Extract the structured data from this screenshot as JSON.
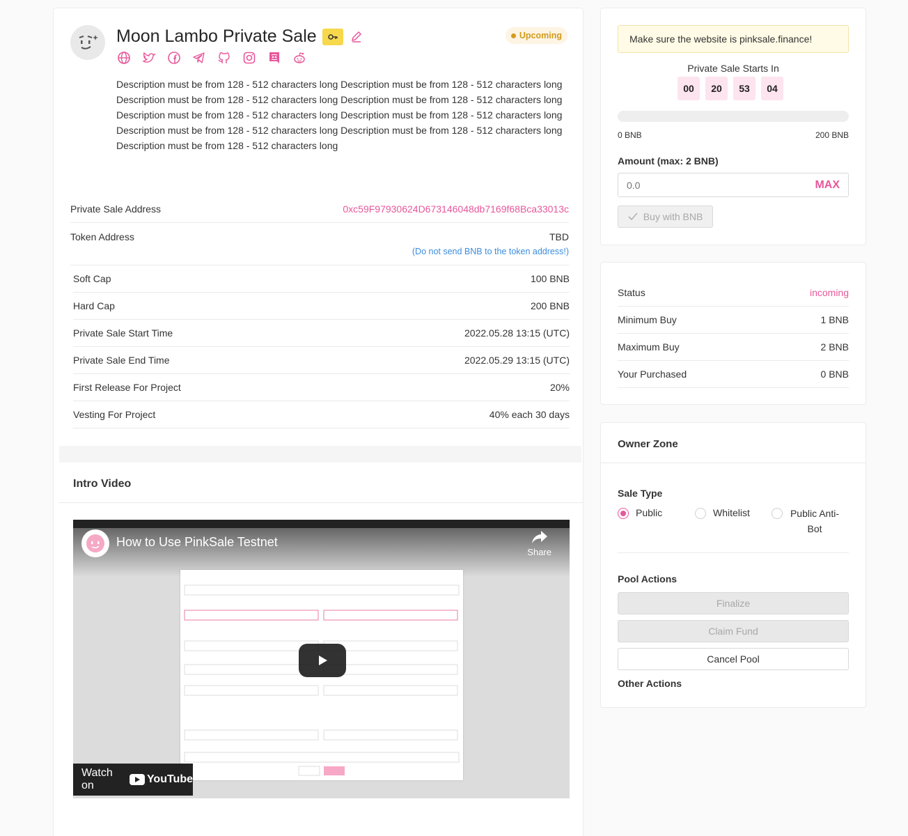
{
  "project": {
    "title": "Moon Lambo Private Sale",
    "status": "Upcoming",
    "description": "Description must be from 128 - 512 characters long Description must be from 128 - 512 characters long Description must be from 128 - 512 characters long Description must be from 128 - 512 characters long Description must be from 128 - 512 characters long Description must be from 128 - 512 characters long Description must be from 128 - 512 characters long Description must be from 128 - 512 characters long Description must be from 128 - 512 characters long",
    "socials": [
      "globe-icon",
      "twitter-icon",
      "facebook-icon",
      "telegram-icon",
      "github-icon",
      "instagram-icon",
      "discord-icon",
      "reddit-icon"
    ]
  },
  "info": {
    "private_sale_address_label": "Private Sale Address",
    "private_sale_address": "0xc59F97930624D673146048db7169f68Bca33013c",
    "token_address_label": "Token Address",
    "token_address": "TBD",
    "token_hint": "(Do not send BNB to the token address!)",
    "rows": [
      {
        "label": "Soft Cap",
        "value": "100 BNB"
      },
      {
        "label": "Hard Cap",
        "value": "200 BNB"
      },
      {
        "label": "Private Sale Start Time",
        "value": "2022.05.28 13:15 (UTC)"
      },
      {
        "label": "Private Sale End Time",
        "value": "2022.05.29 13:15 (UTC)"
      },
      {
        "label": "First Release For Project",
        "value": "20%"
      },
      {
        "label": "Vesting For Project",
        "value": "40% each 30 days"
      }
    ]
  },
  "video": {
    "section_title": "Intro Video",
    "yt_title": "How to Use PinkSale Testnet",
    "share": "Share",
    "watch_on": "Watch on",
    "youtube": "YouTube"
  },
  "sale": {
    "warning": "Make sure the website is pinksale.finance!",
    "starts_label": "Private Sale Starts In",
    "timer": [
      "00",
      "20",
      "53",
      "04"
    ],
    "progress_fraction": 0.0,
    "min_label": "0 BNB",
    "max_label": "200 BNB",
    "amount_label": "Amount (max: 2 BNB)",
    "amount_placeholder": "0.0",
    "max_button": "MAX",
    "buy_button": "Buy with BNB"
  },
  "stats": [
    {
      "label": "Status",
      "value": "incoming"
    },
    {
      "label": "Minimum Buy",
      "value": "1 BNB"
    },
    {
      "label": "Maximum Buy",
      "value": "2 BNB"
    },
    {
      "label": "Your Purchased",
      "value": "0 BNB"
    }
  ],
  "owner": {
    "title": "Owner Zone",
    "sale_type_label": "Sale Type",
    "sale_types": [
      "Public",
      "Whitelist",
      "Public Anti-Bot"
    ],
    "selected_sale_type": "Public",
    "pool_actions_label": "Pool Actions",
    "finalize": "Finalize",
    "claim_fund": "Claim Fund",
    "cancel_pool": "Cancel Pool",
    "other_actions_label": "Other Actions"
  },
  "colors": {
    "accent": "#e8579b",
    "warning_bg": "#fffbe6",
    "status_badge": "#d29b1d",
    "link": "#3c8dde"
  }
}
